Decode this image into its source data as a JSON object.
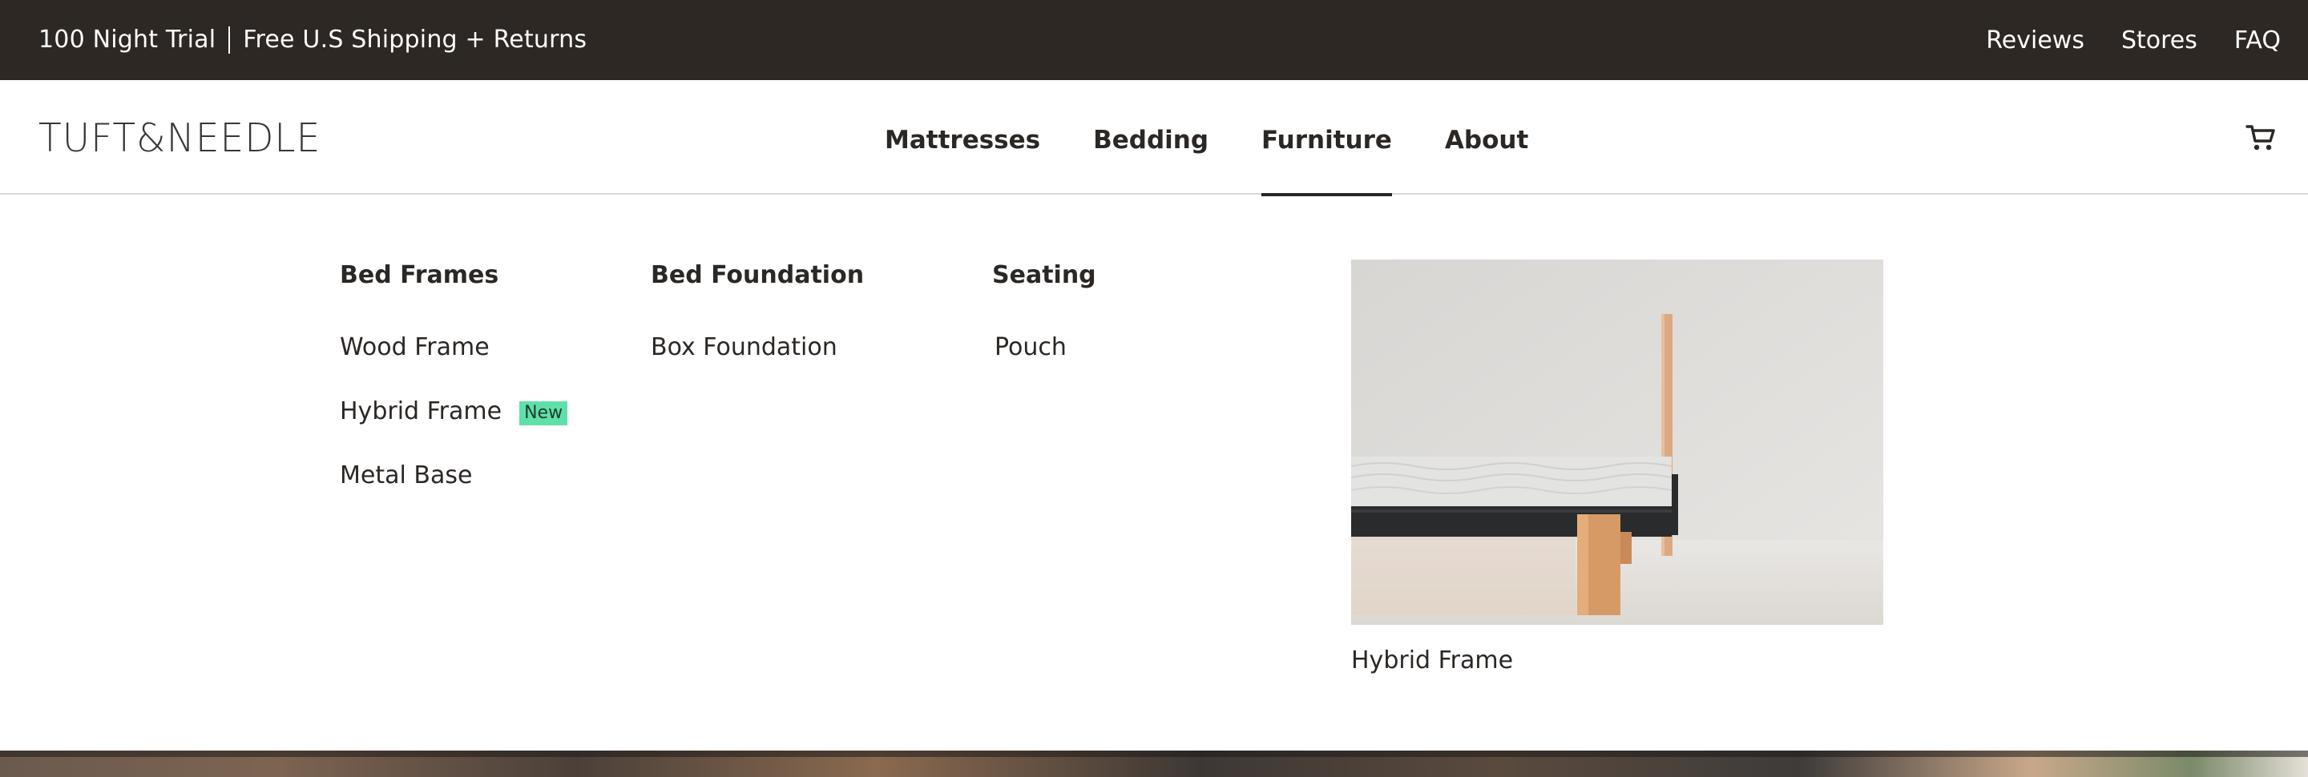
{
  "topbar": {
    "promo_left": "100 Night Trial",
    "promo_right": "Free U.S Shipping + Returns",
    "links": [
      "Reviews",
      "Stores",
      "FAQ"
    ]
  },
  "header": {
    "logo": "TUFT&NEEDLE",
    "nav": [
      "Mattresses",
      "Bedding",
      "Furniture",
      "About"
    ],
    "active_nav": "Furniture",
    "cart_icon": "cart-icon"
  },
  "dropdown": {
    "columns": [
      {
        "title": "Bed Frames",
        "links": [
          "Wood Frame",
          "Hybrid Frame",
          "Metal Base"
        ],
        "badge": "New"
      },
      {
        "title": "Bed Foundation",
        "links": [
          "Box Foundation"
        ]
      },
      {
        "title": "Seating",
        "links": [
          "Pouch"
        ]
      }
    ],
    "feature": {
      "caption": "Hybrid Frame"
    }
  },
  "colors": {
    "topbar_bg": "#2d2823",
    "text": "#2b2724",
    "badge_bg": "#5fe0a9",
    "divider": "#d9d7d5"
  }
}
